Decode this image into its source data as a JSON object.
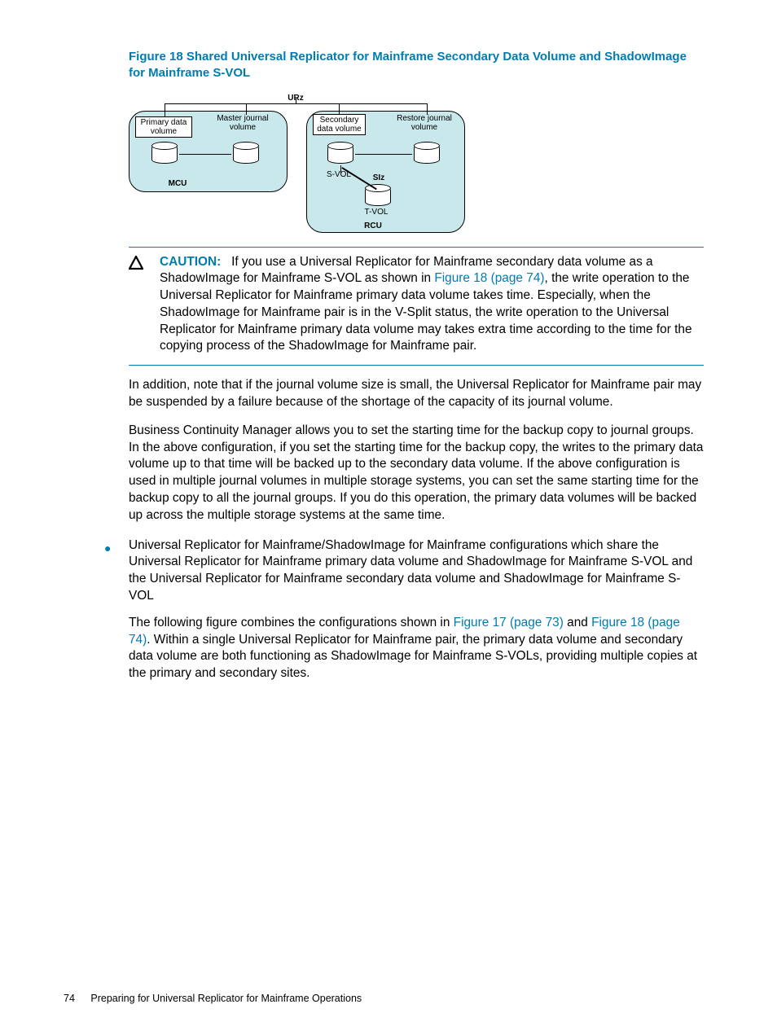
{
  "figure": {
    "caption": "Figure 18 Shared Universal Replicator for Mainframe Secondary Data Volume and ShadowImage for Mainframe S-VOL"
  },
  "diagram": {
    "top_label": "URz",
    "mcu": {
      "label": "MCU",
      "primary": "Primary data\nvolume",
      "master_journal": "Master journal\nvolume"
    },
    "rcu": {
      "label": "RCU",
      "secondary": "Secondary\ndata volume",
      "restore_journal": "Restore journal\nvolume",
      "svol": "S-VOL",
      "tvol": "T-VOL",
      "siz": "SIz"
    }
  },
  "caution": {
    "label": "CAUTION:",
    "text_before": "If you use a Universal Replicator for Mainframe secondary data volume as a ShadowImage for Mainframe S-VOL as shown in ",
    "link": "Figure 18 (page 74)",
    "text_after": ", the write operation to the Universal Replicator for Mainframe primary data volume takes time. Especially, when the ShadowImage for Mainframe pair is in the V-Split status, the write operation to the Universal Replicator for Mainframe primary data volume may takes extra time according to the time for the copying process of the ShadowImage for Mainframe pair."
  },
  "para1": "In addition, note that if the journal volume size is small, the Universal Replicator for Mainframe pair may be suspended by a failure because of the shortage of the capacity of its journal volume.",
  "para2": "Business Continuity Manager allows you to set the starting time for the backup copy to journal groups. In the above configuration, if you set the starting time for the backup copy, the writes to the primary data volume up to that time will be backed up to the secondary data volume. If the above configuration is used in multiple journal volumes in multiple storage systems, you can set the same starting time for the backup copy to all the journal groups. If you do this operation, the primary data volumes will be backed up across the multiple storage systems at the same time.",
  "listItem": {
    "p1": "Universal Replicator for Mainframe/ShadowImage for Mainframe configurations which share the Universal Replicator for Mainframe primary data volume and ShadowImage for Mainframe S-VOL and the Universal Replicator for Mainframe secondary data volume and ShadowImage for Mainframe S-VOL",
    "p2_before": "The following figure combines the configurations shown in ",
    "p2_link1": "Figure 17 (page 73)",
    "p2_mid": " and ",
    "p2_link2": "Figure 18 (page 74)",
    "p2_after": ". Within a single Universal Replicator for Mainframe pair, the primary data volume and secondary data volume are both functioning as ShadowImage for Mainframe S-VOLs, providing multiple copies at the primary and secondary sites."
  },
  "footer": {
    "page": "74",
    "title": "Preparing for Universal Replicator for Mainframe Operations"
  }
}
